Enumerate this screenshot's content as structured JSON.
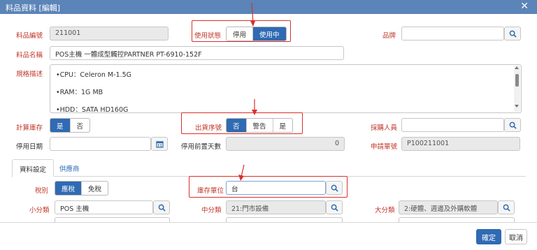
{
  "dialog": {
    "title": "料品資料 [編輯]",
    "close_symbol": "✕"
  },
  "form": {
    "item_no": {
      "label": "料品編號",
      "value": "211001"
    },
    "status": {
      "label": "使用狀態",
      "options": [
        "停用",
        "使用中"
      ],
      "selected": "使用中"
    },
    "brand": {
      "label": "品牌",
      "value": ""
    },
    "item_name": {
      "label": "料品名稱",
      "value": "POS主機 一體成型觸控PARTNER PT-6910-152F"
    },
    "spec": {
      "label": "規格描述",
      "lines": [
        "•CPU：Celeron M-1.5G",
        "•RAM：1G MB",
        "•HDD：SATA HD160G"
      ]
    },
    "count_stock": {
      "label": "計算庫存",
      "options": [
        "是",
        "否"
      ],
      "selected": "是"
    },
    "serial": {
      "label": "出貨序號",
      "options": [
        "否",
        "警告",
        "是"
      ],
      "selected": "否"
    },
    "buyer": {
      "label": "採購人員",
      "value": ""
    },
    "disable_date": {
      "label": "停用日期",
      "value": ""
    },
    "pre_disable_days": {
      "label": "停用前置天數",
      "value": "0"
    },
    "request_no": {
      "label": "申請單號",
      "value": "P100211001"
    }
  },
  "tabs": [
    "資料設定",
    "供應商"
  ],
  "tab_content": {
    "tax": {
      "label": "稅別",
      "options": [
        "應稅",
        "免稅"
      ],
      "selected": "應稅"
    },
    "stock_unit": {
      "label": "庫存單位",
      "value": "台"
    },
    "sub_category": {
      "label": "小分類",
      "value": "POS 主機"
    },
    "mid_category": {
      "label": "中分類",
      "value": "21:門市設備"
    },
    "main_category": {
      "label": "大分類",
      "value": "2:硬體、週邊及外購軟體"
    }
  },
  "footer": {
    "confirm": "確定",
    "cancel": "取消"
  },
  "colors": {
    "title_bar": "#5b84b8",
    "primary": "#2f6ab3",
    "required_label": "#c0392b",
    "highlight": "#d9302c"
  },
  "icons": [
    "close-icon",
    "search-icon",
    "calendar-icon",
    "arrow-icon"
  ]
}
